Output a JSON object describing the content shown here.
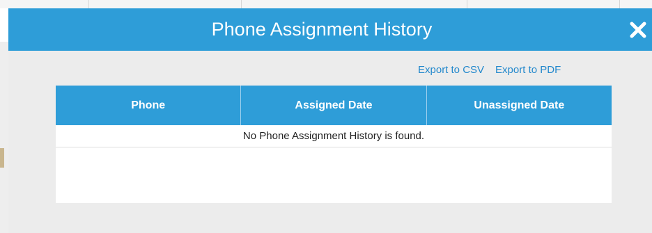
{
  "dialog": {
    "title": "Phone Assignment History",
    "close_icon": "close-icon"
  },
  "toolbar": {
    "export_csv": "Export to CSV",
    "export_pdf": "Export to PDF"
  },
  "table": {
    "columns": [
      "Phone",
      "Assigned Date",
      "Unassigned Date"
    ],
    "empty_message": "No Phone Assignment History is found."
  },
  "colors": {
    "header": "#2e9dd8",
    "link": "#2288cc",
    "dialog_bg": "#ececec"
  }
}
